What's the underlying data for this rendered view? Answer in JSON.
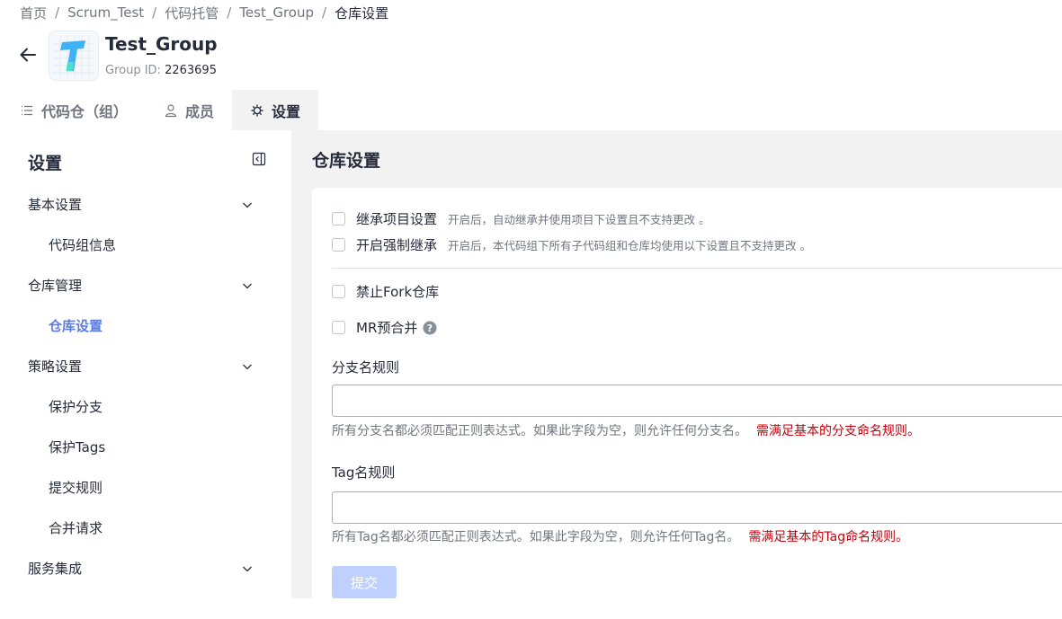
{
  "breadcrumb": {
    "items": [
      "首页",
      "Scrum_Test",
      "代码托管",
      "Test_Group",
      "仓库设置"
    ],
    "separator": "/"
  },
  "header": {
    "back_icon": "arrow-left-icon",
    "title": "Test_Group",
    "group_id_label": "Group ID:",
    "group_id_value": "2263695"
  },
  "tabs": [
    {
      "label": "代码仓（组）",
      "icon": "list-icon",
      "active": false
    },
    {
      "label": "成员",
      "icon": "user-icon",
      "active": false
    },
    {
      "label": "设置",
      "icon": "gear-icon",
      "active": true
    }
  ],
  "sidebar": {
    "title": "设置",
    "collapse_icon": "collapse-sidebar-icon",
    "items": [
      {
        "label": "基本设置",
        "type": "group",
        "icon": "chevron-down-icon"
      },
      {
        "label": "代码组信息",
        "type": "sub"
      },
      {
        "label": "仓库管理",
        "type": "group",
        "icon": "chevron-down-icon"
      },
      {
        "label": "仓库设置",
        "type": "sub",
        "active": true
      },
      {
        "label": "策略设置",
        "type": "group",
        "icon": "chevron-down-icon"
      },
      {
        "label": "保护分支",
        "type": "sub"
      },
      {
        "label": "保护Tags",
        "type": "sub"
      },
      {
        "label": "提交规则",
        "type": "sub"
      },
      {
        "label": "合并请求",
        "type": "sub"
      },
      {
        "label": "服务集成",
        "type": "group",
        "icon": "chevron-down-icon"
      }
    ]
  },
  "main": {
    "title": "仓库设置",
    "inherit": {
      "label": "继承项目设置",
      "desc": "开启后，自动继承并使用项目下设置且不支持更改 。",
      "checked": false
    },
    "force_inherit": {
      "label": "开启强制继承",
      "desc": "开启后，本代码组下所有子代码组和仓库均使用以下设置且不支持更改 。",
      "checked": false
    },
    "forbid_fork": {
      "label": "禁止Fork仓库",
      "checked": false
    },
    "mr_premerge": {
      "label": "MR预合并",
      "checked": false,
      "help_icon": "question-circle-icon"
    },
    "branch_rule": {
      "label": "分支名规则",
      "value": "",
      "hint": "所有分支名都必须匹配正则表达式。如果此字段为空，则允许任何分支名。",
      "warning": "需满足基本的分支命名规则。"
    },
    "tag_rule": {
      "label": "Tag名规则",
      "value": "",
      "hint": "所有Tag名都必须匹配正则表达式。如果此字段为空，则允许任何Tag名。",
      "warning": "需满足基本的Tag命名规则。"
    },
    "submit_label": "提交"
  },
  "colors": {
    "accent": "#5e7ce0",
    "warning": "#c7000b",
    "submit_disabled": "#bed1fe",
    "page_bg": "#f2f2f3"
  }
}
